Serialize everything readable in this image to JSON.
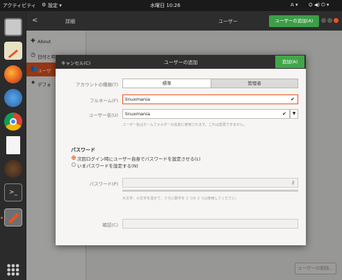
{
  "topbar": {
    "activities": "アクティビティ",
    "app_menu": "設定 ▾",
    "clock": "水曜日 10:26",
    "input_method": "A ▾",
    "system_icons": "⛭ ◀) ⏻ ▾"
  },
  "settings": {
    "back_label": "<",
    "title": "詳細",
    "users_title": "ユーザー",
    "add_user_button": "ユーザーの追加(A)",
    "sidebar": [
      {
        "icon": "plus-icon",
        "label": "About"
      },
      {
        "icon": "clock-icon",
        "label": "日付と時"
      },
      {
        "icon": "users-icon",
        "label": "ユーザ"
      },
      {
        "icon": "star-icon",
        "label": "デフォ"
      }
    ],
    "remove_user_button": "ユーザーの削除…"
  },
  "dialog": {
    "cancel": "キャンセル(C)",
    "title": "ユーザーの追加",
    "add": "追加(A)",
    "account_type_label": "アカウントの種類(T)",
    "account_types": [
      "標準",
      "管理者"
    ],
    "fullname_label": "フルネーム(F)",
    "fullname_value": "linuxmania",
    "username_label": "ユーザー名(U)",
    "username_value": "linuxmania",
    "username_hint": "ユーザー名はホームフォルダーの名前に使用されます。これは変更できません。",
    "password_section": "パスワード",
    "radio_next_login": "次回ログイン時にユーザー自身でパスワードを設定させる(L)",
    "radio_set_now": "いまパスワードを設定する(N)",
    "password_label": "パスワード(P)",
    "password_hint": "大文字、小文字を混ぜて、さらに数字を 1 つか 2 つは使用してください。",
    "confirm_label": "確認(C)"
  },
  "colors": {
    "accent_orange": "#e95420",
    "green_button": "#41a64a",
    "dark_header": "#2f2f2f"
  }
}
